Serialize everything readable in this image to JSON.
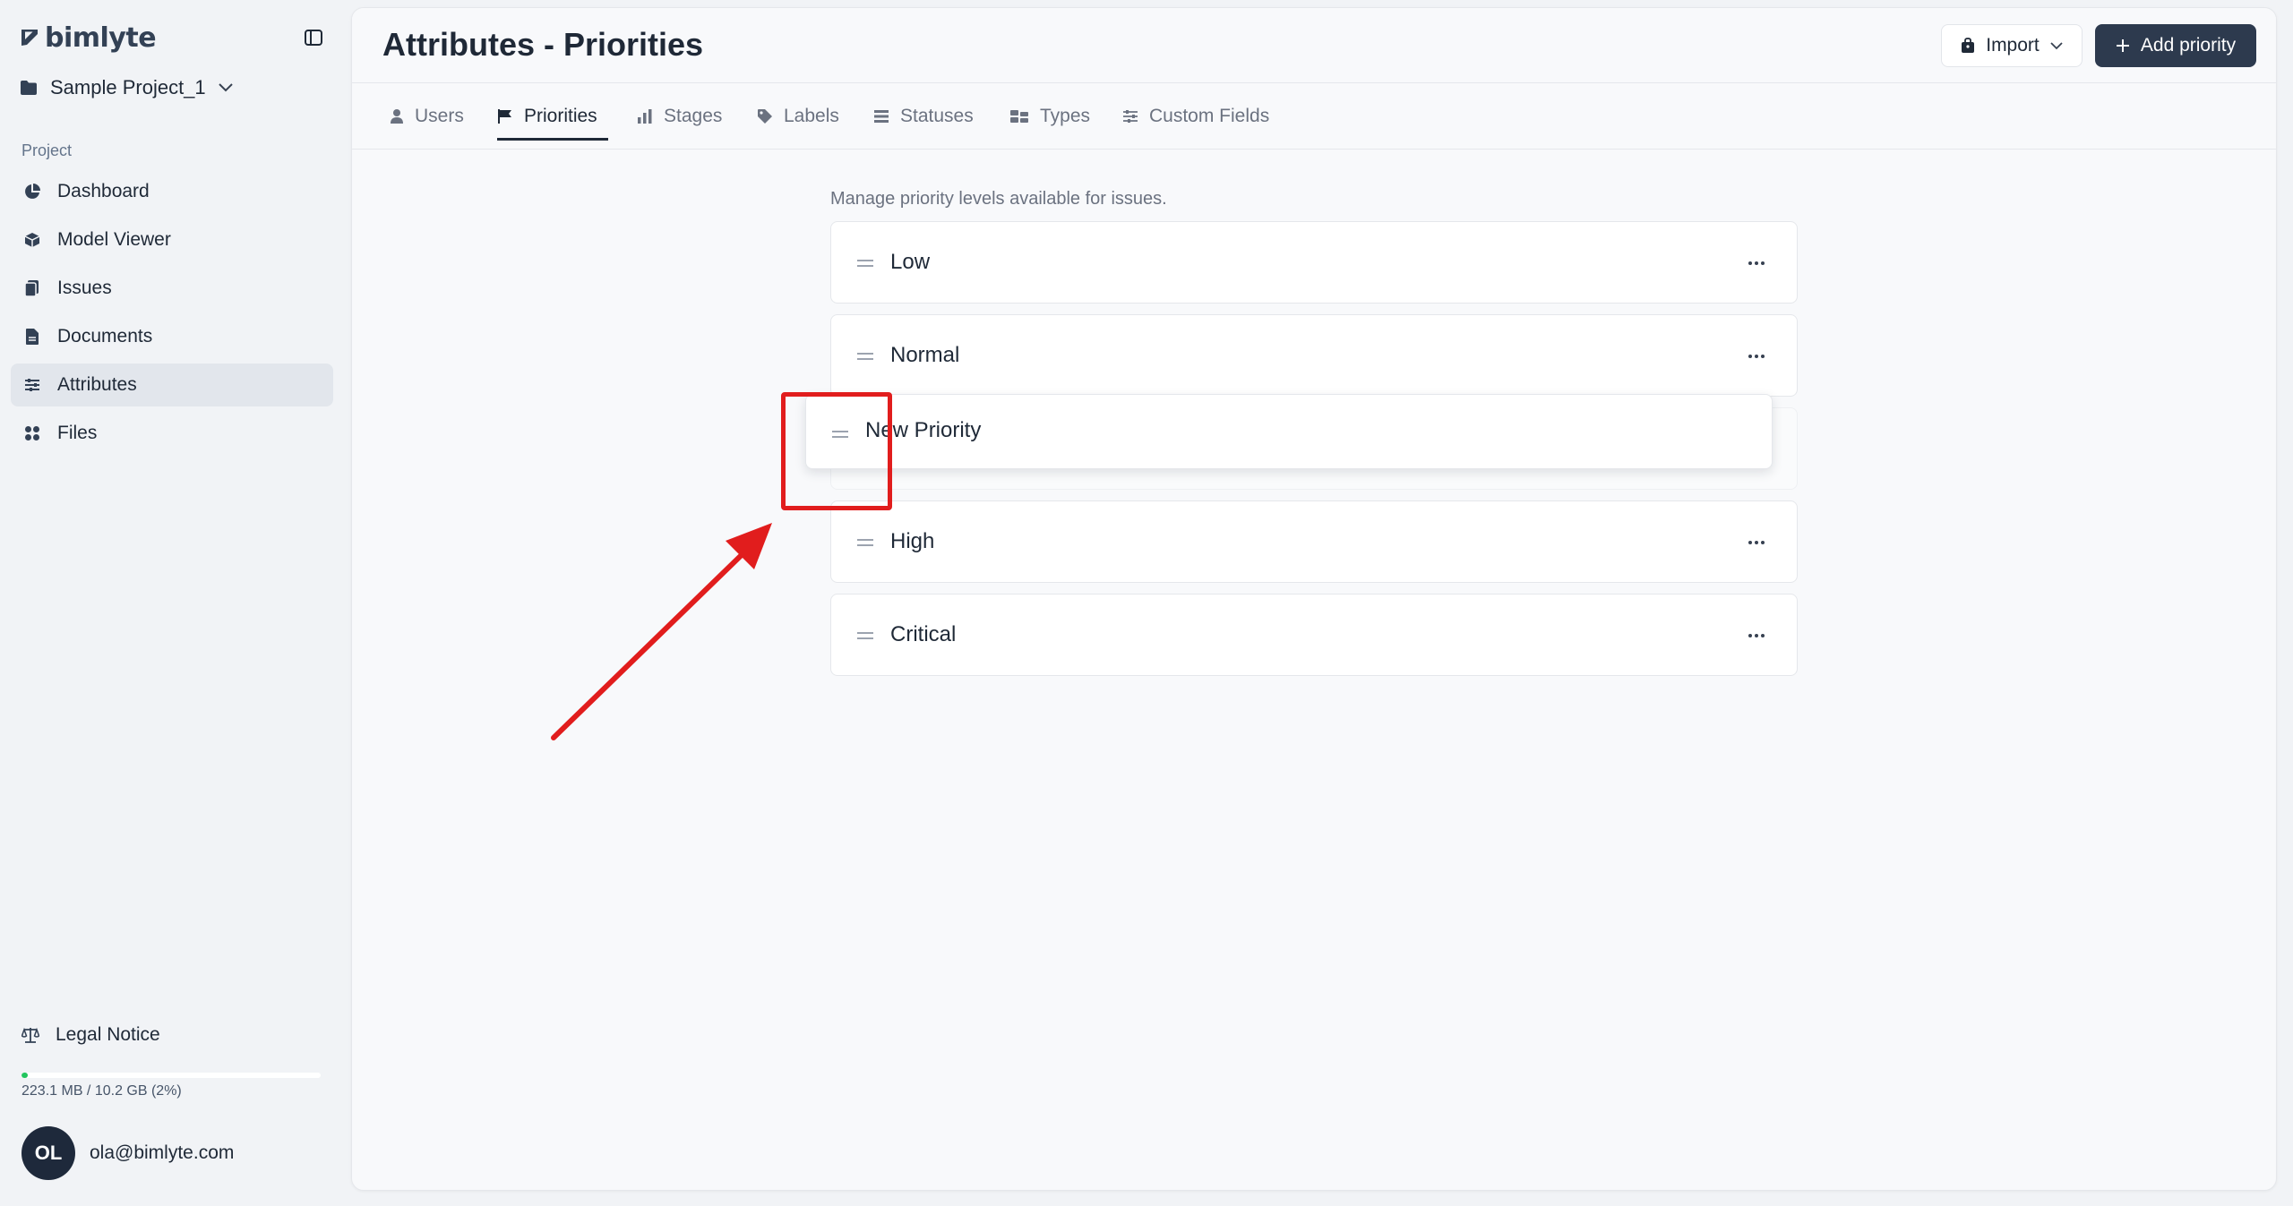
{
  "app": {
    "brand": "bimlyte"
  },
  "sidebar": {
    "project_name": "Sample Project_1",
    "section_label": "Project",
    "items": [
      {
        "label": "Dashboard",
        "icon": "pie-chart-icon",
        "active": false
      },
      {
        "label": "Model Viewer",
        "icon": "cube-icon",
        "active": false
      },
      {
        "label": "Issues",
        "icon": "clipboard-icon",
        "active": false
      },
      {
        "label": "Documents",
        "icon": "document-icon",
        "active": false
      },
      {
        "label": "Attributes",
        "icon": "sliders-icon",
        "active": true
      },
      {
        "label": "Files",
        "icon": "grid-icon",
        "active": false
      }
    ],
    "legal_notice": "Legal Notice",
    "storage": {
      "text": "223.1 MB / 10.2 GB (2%)",
      "percent": 2
    },
    "user": {
      "initials": "OL",
      "email": "ola@bimlyte.com"
    }
  },
  "header": {
    "title": "Attributes - Priorities",
    "import_label": "Import",
    "add_label": "Add priority"
  },
  "tabs": [
    {
      "label": "Users",
      "icon": "user-icon",
      "active": false
    },
    {
      "label": "Priorities",
      "icon": "flag-icon",
      "active": true
    },
    {
      "label": "Stages",
      "icon": "bar-chart-icon",
      "active": false
    },
    {
      "label": "Labels",
      "icon": "tag-icon",
      "active": false
    },
    {
      "label": "Statuses",
      "icon": "list-icon",
      "active": false
    },
    {
      "label": "Types",
      "icon": "types-icon",
      "active": false
    },
    {
      "label": "Custom Fields",
      "icon": "sliders-icon",
      "active": false
    }
  ],
  "content": {
    "description": "Manage priority levels available for issues.",
    "priorities": [
      "Low",
      "Normal",
      "High",
      "Critical"
    ],
    "dragging_item": "New Priority"
  },
  "colors": {
    "accent": "#2d3a4e",
    "annotation": "#e11d1d",
    "storage_fill": "#22c55e"
  }
}
